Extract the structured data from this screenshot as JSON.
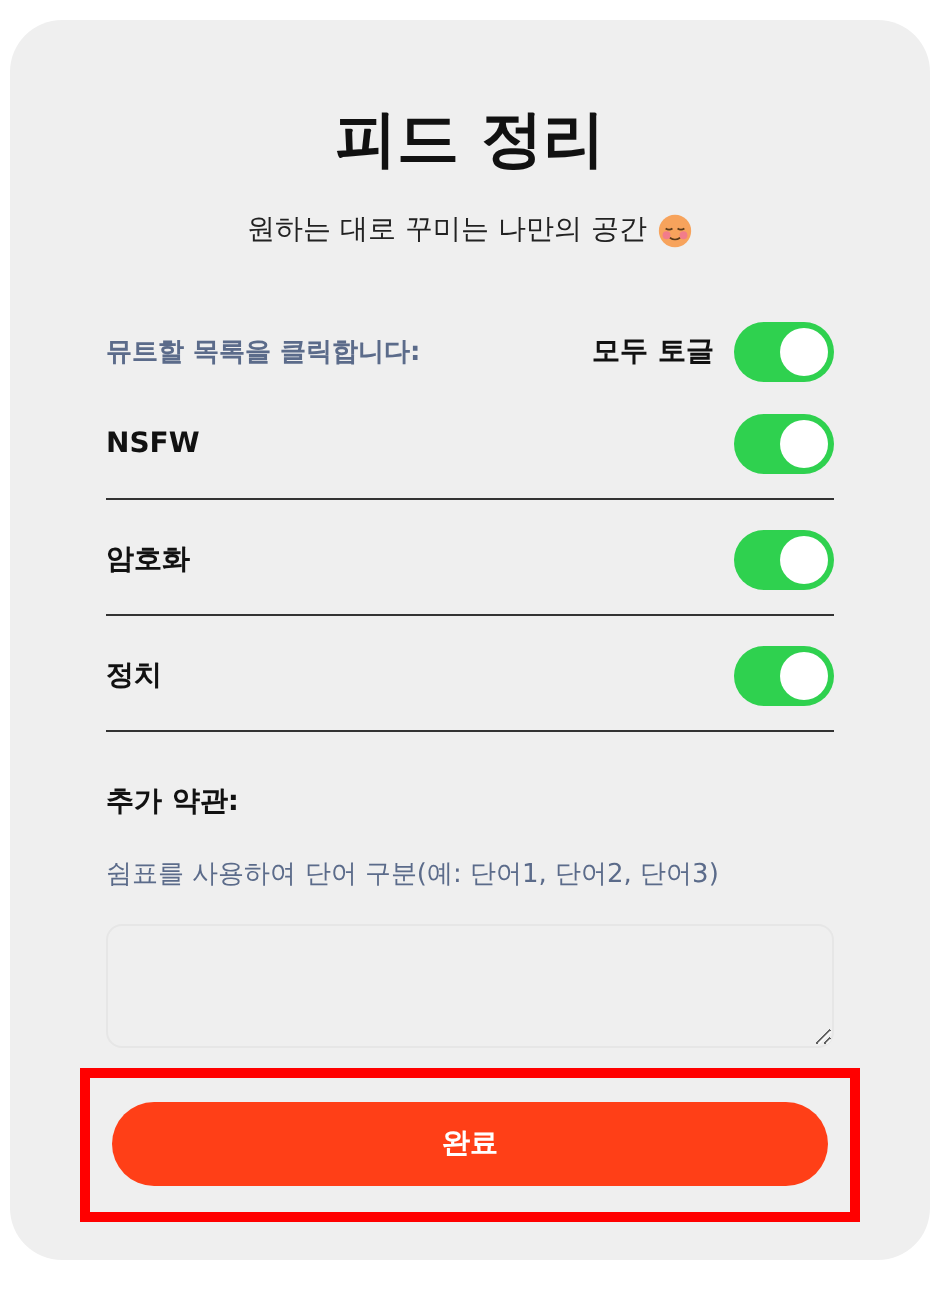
{
  "title": "피드 정리",
  "subtitle": "원하는 대로 꾸미는 나만의 공간",
  "mute_hint": "뮤트할 목록을 클릭합니다:",
  "toggle_all": {
    "label": "모두 토글",
    "on": true
  },
  "filters": [
    {
      "label": "NSFW",
      "on": true
    },
    {
      "label": "암호화",
      "on": true
    },
    {
      "label": "정치",
      "on": true
    }
  ],
  "extra_terms": {
    "label": "추가 약관:",
    "hint": "쉼표를 사용하여 단어 구분(예: 단어1, 단어2, 단어3)"
  },
  "done_button": {
    "label": "완료",
    "highlighted": true
  }
}
